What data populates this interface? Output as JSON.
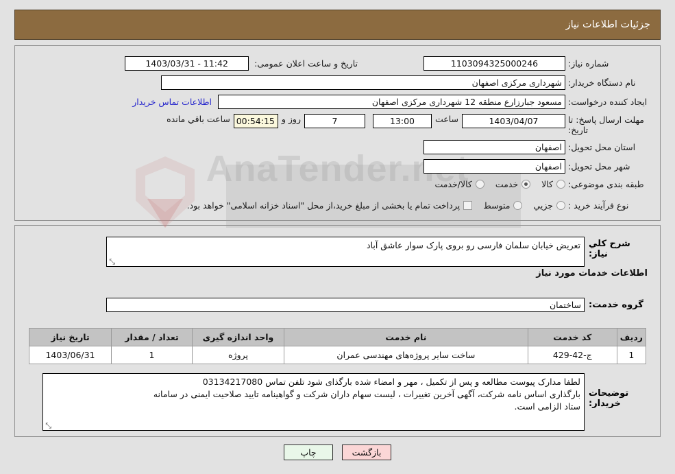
{
  "header": {
    "title": "جزئیات اطلاعات نیاز"
  },
  "watermark": {
    "text": "AnaTender.net"
  },
  "form": {
    "need_number_label": "شماره نیاز:",
    "need_number_value": "1103094325000246",
    "announce_label": "تاریخ و ساعت اعلان عمومی:",
    "announce_value": "11:42 - 1403/03/31",
    "buyer_org_label": "نام دستگاه خریدار:",
    "buyer_org_value": "شهرداری مرکزی اصفهان",
    "buyer_org_extra_value": "",
    "creator_label": "ایجاد کننده درخواست:",
    "creator_value": "مسعود جبارزارع منطقه 12 شهرداری مرکزی اصفهان",
    "contact_link": "اطلاعات تماس خریدار",
    "deadline_label": "مهلت ارسال پاسخ: تا تاریخ:",
    "deadline_date": "1403/04/07",
    "hour_label": "ساعت",
    "deadline_time": "13:00",
    "remaining_days": "7",
    "days_and_label": "روز و",
    "remaining_clock": "00:54:15",
    "remaining_suffix": "ساعت باقي مانده",
    "province_label": "استان محل تحویل:",
    "province_value": "اصفهان",
    "city_label": "شهر محل تحویل:",
    "city_value": "اصفهان",
    "category_label": "طبقه بندی موضوعی:",
    "category_options": [
      {
        "label": "کالا",
        "selected": false
      },
      {
        "label": "خدمت",
        "selected": true
      },
      {
        "label": "کالا/خدمت",
        "selected": false
      }
    ],
    "process_label": "نوع فرآیند خرید :",
    "process_options": [
      {
        "label": "جزیي",
        "selected": false
      },
      {
        "label": "متوسط",
        "selected": false
      }
    ],
    "treasury_checkbox_label": "پرداخت تمام یا بخشی از مبلغ خرید،از محل \"اسناد خزانه اسلامی\" خواهد بود.",
    "treasury_checked": false
  },
  "description": {
    "label": "شرح کلي نیاز:",
    "value": "تعریض خیابان سلمان فارسی رو بروی پارک سوار عاشق آباد"
  },
  "services": {
    "section_title": "اطلاعات خدمات مورد نیاز",
    "group_label": "گروه خدمت:",
    "group_value": "ساختمان",
    "columns": [
      "ردیف",
      "کد خدمت",
      "نام خدمت",
      "واحد اندازه گیری",
      "تعداد / مقدار",
      "تاریخ نیاز"
    ],
    "rows": [
      {
        "index": "1",
        "code": "ج-42-429",
        "name": "ساخت سایر پروژه‌های مهندسی عمران",
        "unit": "پروژه",
        "quantity": "1",
        "need_date": "1403/06/31"
      }
    ]
  },
  "buyer_notes": {
    "label": "توضیحات خریدار:",
    "line1": "لطفا مدارک پیوست مطالعه و پس از تکمیل ، مهر و امضاء شده بارگذای شود تلفن تماس 03134217080",
    "line2": "بارگذاری اساس نامه شرکت، آگهی آخرین تغییرات ، لیست سهام داران شرکت و گواهینامه تایید صلاحیت ایمنی در سامانه",
    "line3": "ستاد الزامی است."
  },
  "buttons": {
    "print": "چاپ",
    "back": "بازگشت"
  },
  "colors": {
    "header_brown": "#8c6b40",
    "page_bg": "#e2e2e2",
    "link_blue": "#2525cc",
    "timer_bg": "#fbf8dd",
    "table_header": "#c3c3c3",
    "btn_print_bg": "#e9f7e9",
    "btn_back_bg": "#fbd6d6"
  }
}
